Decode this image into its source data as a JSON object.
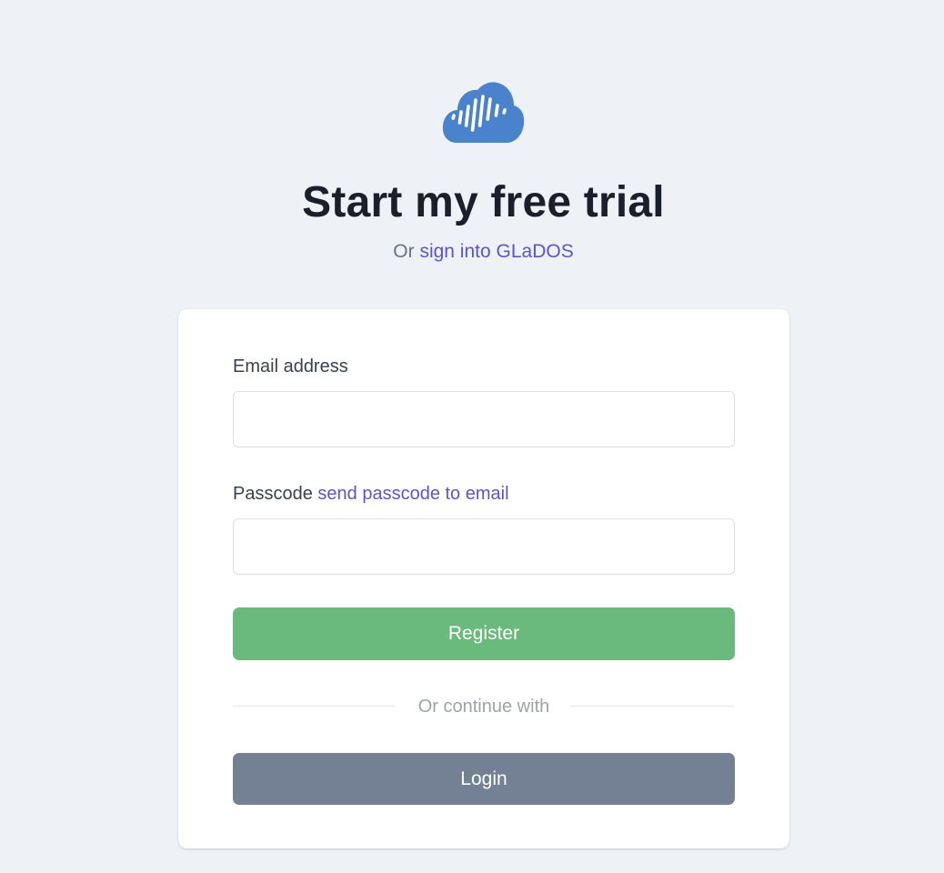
{
  "page": {
    "title": "Start my free trial",
    "subtitle_prefix": "Or",
    "subtitle_link": "sign into GLaDOS"
  },
  "form": {
    "email_label": "Email address",
    "email_value": "",
    "email_placeholder": "",
    "passcode_label": "Passcode",
    "passcode_link": "send passcode to email",
    "passcode_value": "",
    "passcode_placeholder": "",
    "register_label": "Register",
    "divider_text": "Or continue with",
    "login_label": "Login"
  },
  "icons": {
    "logo": "cloud-soundwave-icon"
  },
  "colors": {
    "background": "#eef1f6",
    "logo": "#4a82cc",
    "link": "#5856c9",
    "register_button": "#69ba7c",
    "login_button": "#748093"
  }
}
